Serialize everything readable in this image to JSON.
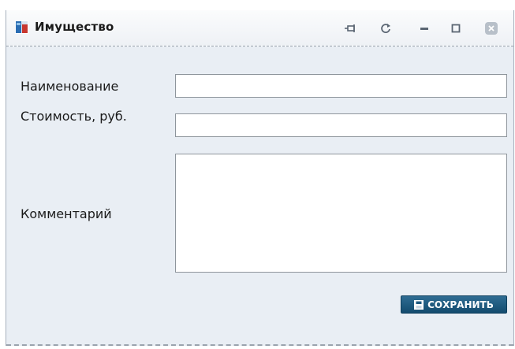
{
  "window": {
    "title": "Имущество",
    "icons": {
      "app": "property-icon",
      "pin": "pin-icon",
      "refresh": "refresh-icon",
      "minimize": "minimize-icon",
      "maximize": "maximize-icon",
      "close": "close-icon"
    }
  },
  "form": {
    "name_label": "Наименование",
    "name_value": "",
    "cost_label": "Стоимость, руб.",
    "cost_value": "",
    "comment_label": "Комментарий",
    "comment_value": "",
    "save_label": "СОХРАНИТЬ",
    "save_icon": "floppy-disk-icon"
  },
  "colors": {
    "accent": "#1e5a80",
    "panel_background": "#e9eef4"
  }
}
